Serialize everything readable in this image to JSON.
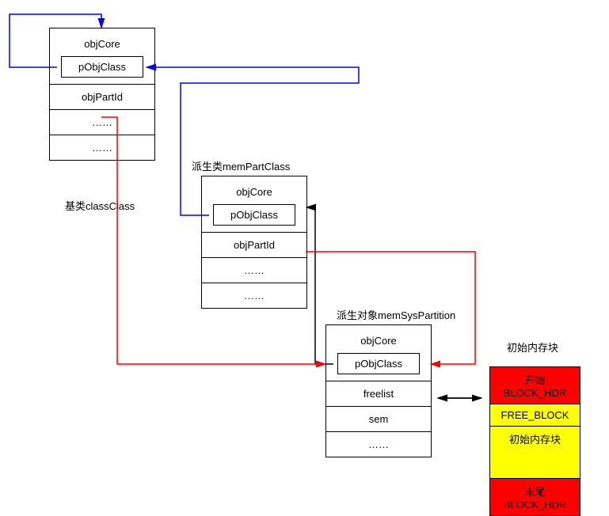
{
  "classClass": {
    "label": "基类classClass",
    "cells": [
      "objCore",
      "pObjClass",
      "objPartId",
      "……",
      "……"
    ]
  },
  "memPartClass": {
    "label": "派生类memPartClass",
    "cells": [
      "objCore",
      "pObjClass",
      "objPartId",
      "……",
      "……"
    ]
  },
  "memSysPartition": {
    "label": "派生对象memSysPartition",
    "cells": [
      "objCore",
      "pObjClass",
      "freelist",
      "sem",
      "……"
    ]
  },
  "memBlock": {
    "label": "初始内存块",
    "cells": [
      "开始BLOCK_HDR",
      "FREE_BLOCK",
      "初始内存块",
      "末尾BLOCK_HDR"
    ]
  }
}
